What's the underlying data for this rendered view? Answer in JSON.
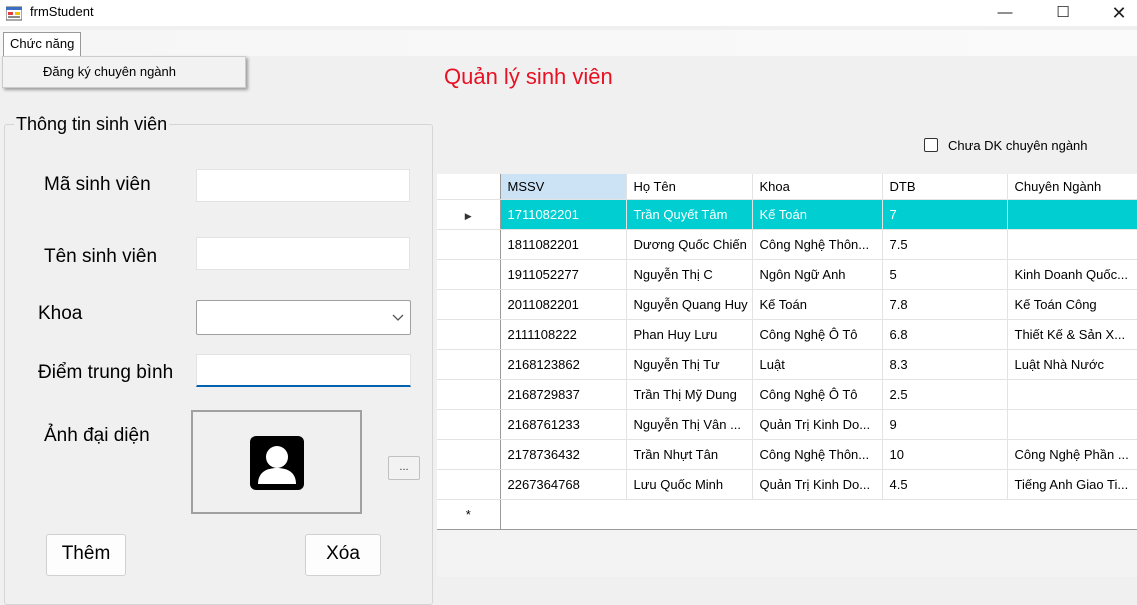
{
  "window": {
    "title": "frmStudent",
    "minimize_glyph": "—",
    "maximize_glyph": "☐",
    "close_glyph": "✕"
  },
  "menu": {
    "root_label": "Chức năng",
    "items": [
      {
        "label": "Đăng ký chuyên ngành"
      }
    ]
  },
  "page_title": "Quản lý sinh viên",
  "form": {
    "group_title": "Thông tin sinh viên",
    "student_id_label": "Mã sinh viên",
    "student_id_value": "",
    "student_name_label": "Tên sinh viên",
    "student_name_value": "",
    "faculty_label": "Khoa",
    "faculty_value": "",
    "gpa_label": "Điểm trung bình",
    "gpa_value": "",
    "avatar_label": "Ảnh đại diện",
    "browse_label": "...",
    "add_button": "Thêm",
    "delete_button": "Xóa"
  },
  "filter": {
    "unregistered_label": "Chưa DK chuyên ngành",
    "unregistered_checked": false
  },
  "grid": {
    "columns": [
      "MSSV",
      "Họ Tên",
      "Khoa",
      "DTB",
      "Chuyên Ngành"
    ],
    "sorted_column": 0,
    "selected_row": 0,
    "rows": [
      [
        "1711082201",
        "Trần Quyết Tâm",
        "Kế Toán",
        "7",
        ""
      ],
      [
        "1811082201",
        "Dương Quốc Chiến",
        "Công Nghệ Thôn...",
        "7.5",
        ""
      ],
      [
        "1911052277",
        "Nguyễn Thị C",
        "Ngôn Ngữ Anh",
        "5",
        "Kinh Doanh Quốc..."
      ],
      [
        "2011082201",
        "Nguyễn Quang Huy",
        "Kế Toán",
        "7.8",
        "Kế Toán Công"
      ],
      [
        "2111108222",
        "Phan Huy Lưu",
        "Công Nghệ Ô Tô",
        "6.8",
        "Thiết Kế & Sản X..."
      ],
      [
        "2168123862",
        "Nguyễn Thị Tư",
        "Luật",
        "8.3",
        "Luật Nhà Nước"
      ],
      [
        "2168729837",
        "Trần Thị Mỹ Dung",
        "Công Nghệ Ô Tô",
        "2.5",
        ""
      ],
      [
        "2168761233",
        "Nguyễn Thị Vân ...",
        "Quản Trị Kinh Do...",
        "9",
        ""
      ],
      [
        "2178736432",
        "Trần Nhựt Tân",
        "Công Nghệ Thôn...",
        "10",
        "Công Nghệ Phần ..."
      ],
      [
        "2267364768",
        "Lưu Quốc Minh",
        "Quản Trị Kinh Do...",
        "4.5",
        "Tiếng Anh Giao Ti..."
      ]
    ],
    "current_row_glyph": "▶",
    "new_row_glyph": "*"
  },
  "colors": {
    "title_red": "#e81123",
    "selected_row": "#00ced1",
    "sorted_header": "#cce3f5",
    "focus_underline": "#0063b1"
  }
}
